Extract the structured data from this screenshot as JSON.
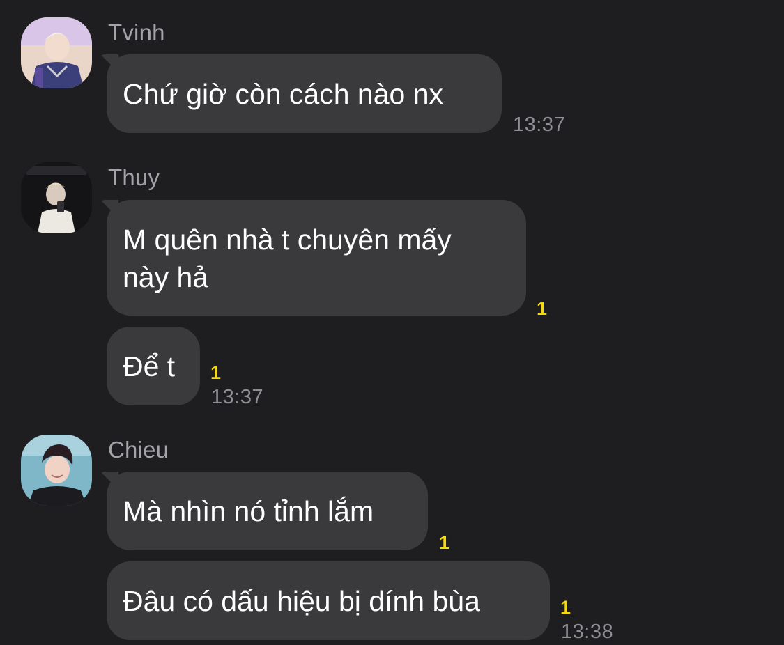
{
  "messages": [
    {
      "sender": "Tvinh",
      "avatar_icon": "avatar-tvinh-icon",
      "bubbles": [
        {
          "text": "Chứ giờ còn cách nào nx",
          "unread": "",
          "time": "13:37"
        }
      ]
    },
    {
      "sender": "Thuy",
      "avatar_icon": "avatar-thuy-icon",
      "bubbles": [
        {
          "text": "M quên nhà t chuyên mấy\nnày hả",
          "unread": "1",
          "time": ""
        },
        {
          "text": "Để t",
          "unread": "1",
          "time": "13:37"
        }
      ]
    },
    {
      "sender": "Chieu",
      "avatar_icon": "avatar-chieu-icon",
      "bubbles": [
        {
          "text": "Mà nhìn nó tỉnh lắm",
          "unread": "1",
          "time": ""
        },
        {
          "text": "Đâu có dấu hiệu bị dính bùa",
          "unread": "1",
          "time": "13:38"
        }
      ]
    }
  ],
  "colors": {
    "background": "#1e1e20",
    "bubble": "#3a3a3c",
    "unread": "#f5d90a",
    "sender": "#a3a3a8",
    "time": "#8e8e93"
  }
}
